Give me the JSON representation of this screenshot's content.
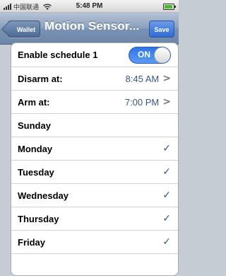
{
  "status_bar": {
    "carrier": "中国联通",
    "time": "5:48 PM"
  },
  "nav": {
    "back_label": "Wallet",
    "title": "Motion Sensor...",
    "save_label": "Save"
  },
  "schedule": {
    "enable_label": "Enable schedule 1",
    "toggle_state": "ON",
    "disarm_label": "Disarm at:",
    "disarm_value": "8:45 AM",
    "arm_label": "Arm at:",
    "arm_value": "7:00 PM",
    "days": [
      {
        "name": "Sunday",
        "checked": false
      },
      {
        "name": "Monday",
        "checked": true
      },
      {
        "name": "Tuesday",
        "checked": true
      },
      {
        "name": "Wednesday",
        "checked": true
      },
      {
        "name": "Thursday",
        "checked": true
      },
      {
        "name": "Friday",
        "checked": true
      }
    ],
    "checkmark": "✓",
    "chevron": ">"
  },
  "colors": {
    "nav_bar": "#7a92b3",
    "save_button": "#2f6cd6",
    "toggle_on": "#3b82ea",
    "value_text": "#385487"
  }
}
